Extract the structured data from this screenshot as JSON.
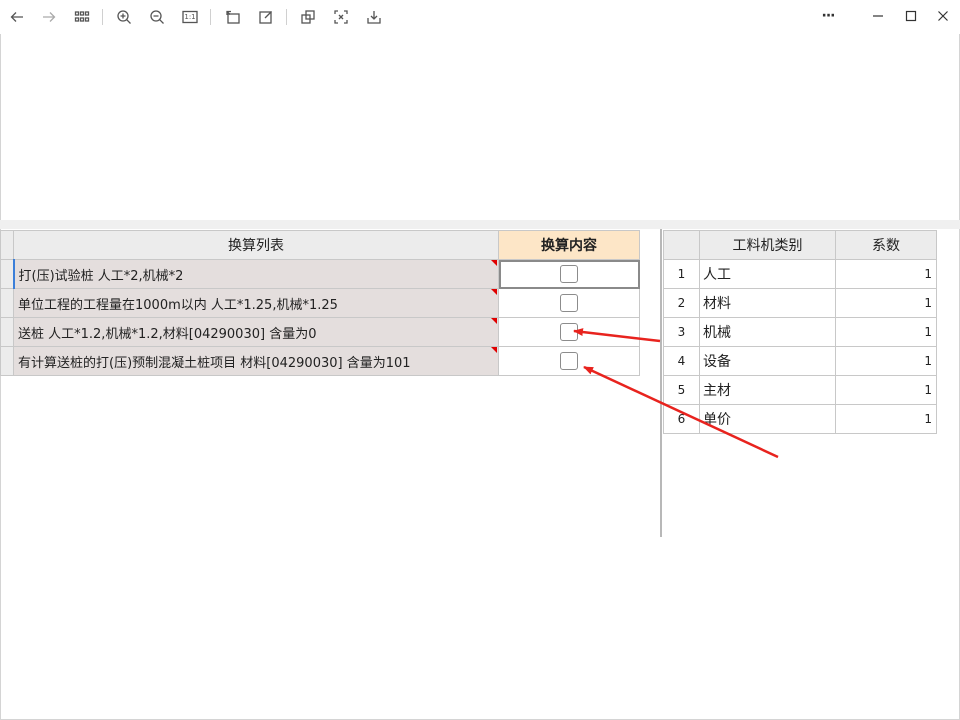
{
  "toolbar": {
    "buttons": [
      "back-icon",
      "forward-icon",
      "grid-view-icon",
      "zoom-in-icon",
      "zoom-out-icon",
      "actual-size-icon",
      "rotate-icon",
      "edit-icon",
      "copy-icon",
      "fit-icon",
      "download-icon"
    ],
    "actual_size_label": "1:1"
  },
  "window": {
    "more": "···",
    "buttons": [
      "minimize-icon",
      "maximize-icon",
      "close-icon"
    ]
  },
  "left_table": {
    "header_list": "换算列表",
    "header_content": "换算内容",
    "rows": [
      {
        "text": "打(压)试验桩 人工*2,机械*2",
        "checked": false
      },
      {
        "text": "单位工程的工程量在1000m以内 人工*1.25,机械*1.25",
        "checked": false
      },
      {
        "text": "送桩 人工*1.2,机械*1.2,材料[04290030] 含量为0",
        "checked": false
      },
      {
        "text": "有计算送桩的打(压)预制混凝土桩项目 材料[04290030] 含量为101",
        "checked": false
      }
    ]
  },
  "right_table": {
    "header_category": "工料机类别",
    "header_coef": "系数",
    "rows": [
      {
        "num": "1",
        "category": "人工",
        "coef": "1"
      },
      {
        "num": "2",
        "category": "材料",
        "coef": "1"
      },
      {
        "num": "3",
        "category": "机械",
        "coef": "1"
      },
      {
        "num": "4",
        "category": "设备",
        "coef": "1"
      },
      {
        "num": "5",
        "category": "主材",
        "coef": "1"
      },
      {
        "num": "6",
        "category": "单价",
        "coef": "1"
      }
    ]
  },
  "colors": {
    "arrow": "#e8231e",
    "header_highlight": "#fde6c7",
    "row_bg": "#e4dedd",
    "selection": "#3b7fd9"
  }
}
